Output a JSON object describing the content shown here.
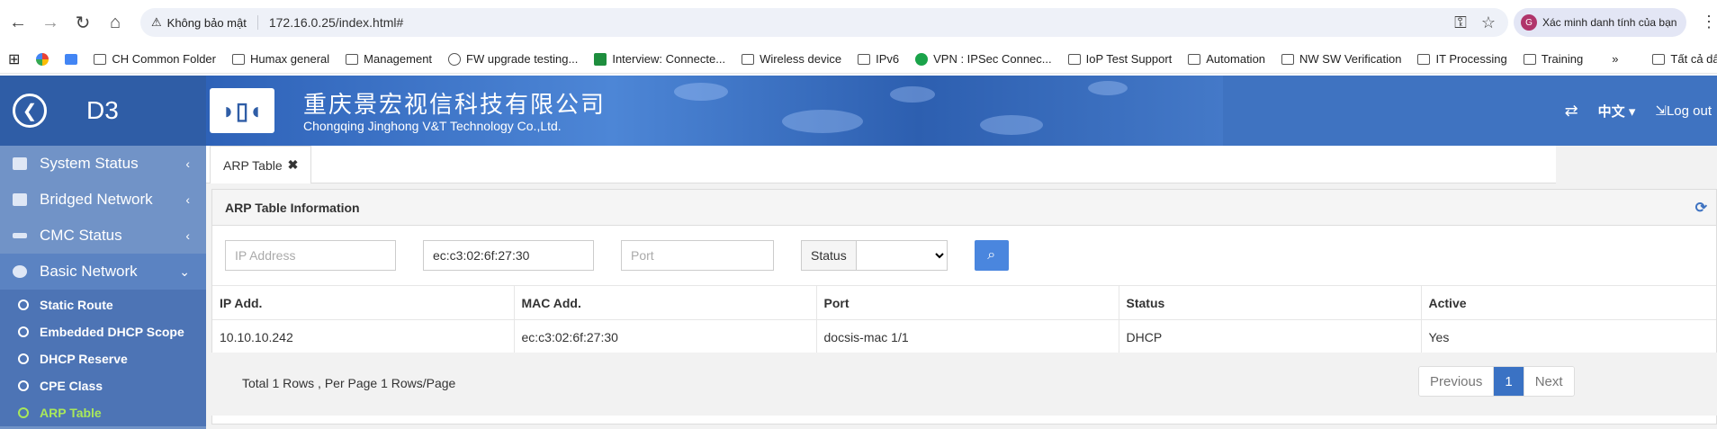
{
  "browser": {
    "security_label": "Không bảo mật",
    "url": "172.16.0.25/index.html#",
    "profile_label": "Xác minh danh tính của bạn",
    "profile_initial": "G",
    "bookmarks": [
      "CH Common Folder",
      "Humax general",
      "Management",
      "FW upgrade testing...",
      "Interview: Connecte...",
      "Wireless device",
      "IPv6",
      "VPN : IPSec Connec...",
      "IoP Test Support",
      "Automation",
      "NW SW Verification",
      "IT Processing",
      "Training"
    ],
    "bookmarks_more": "»",
    "all_bookmarks": "Tất cả dấu trang"
  },
  "header": {
    "device_name": "D3",
    "company_cn": "重庆景宏视信科技有限公司",
    "company_en": "Chongqing Jinghong V&T Technology Co.,Ltd.",
    "language": "中文",
    "logout": "Log out"
  },
  "sidebar": {
    "items": [
      {
        "label": "System Status",
        "chevron": "‹"
      },
      {
        "label": "Bridged Network",
        "chevron": "‹"
      },
      {
        "label": "CMC Status",
        "chevron": "‹"
      },
      {
        "label": "Basic Network",
        "chevron": "⌄"
      }
    ],
    "subitems": [
      {
        "label": "Static Route"
      },
      {
        "label": "Embedded DHCP Scope"
      },
      {
        "label": "DHCP Reserve"
      },
      {
        "label": "CPE Class"
      },
      {
        "label": "ARP Table"
      }
    ]
  },
  "main": {
    "tab_label": "ARP Table",
    "panel_title": "ARP Table Information",
    "filters": {
      "ip_placeholder": "IP Address",
      "mac_value": "ec:c3:02:6f:27:30",
      "port_placeholder": "Port",
      "status_label": "Status"
    },
    "table": {
      "headers": [
        "IP Add.",
        "MAC Add.",
        "Port",
        "Status",
        "Active"
      ],
      "rows": [
        [
          "10.10.10.242",
          "ec:c3:02:6f:27:30",
          "docsis-mac 1/1",
          "DHCP",
          "Yes"
        ]
      ]
    },
    "footer": {
      "summary": "Total 1 Rows , Per Page 1 Rows/Page",
      "prev": "Previous",
      "page": "1",
      "next": "Next"
    }
  }
}
